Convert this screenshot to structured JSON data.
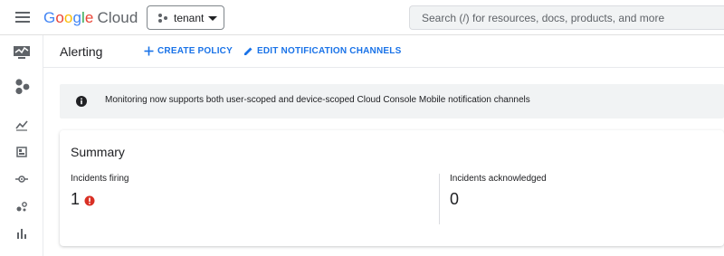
{
  "topbar": {
    "logo": {
      "g1": "G",
      "g2": "o",
      "g3": "o",
      "g4": "g",
      "g5": "l",
      "g6": "e",
      "cloud": "Cloud"
    },
    "project": "tenant",
    "search_placeholder": "Search (/) for resources, docs, products, and more",
    "icons": {
      "menu": "hamburger-menu-icon",
      "project": "project-dots-icon",
      "dropdown": "caret-down-icon"
    }
  },
  "sidebar": {
    "items": [
      {
        "name": "monitoring-product-icon"
      },
      {
        "name": "product-logo-icon"
      },
      {
        "name": "metrics-explorer-icon"
      },
      {
        "name": "dashboards-icon"
      },
      {
        "name": "integrations-icon"
      },
      {
        "name": "services-icon"
      },
      {
        "name": "bar-chart-icon"
      }
    ]
  },
  "header": {
    "title": "Alerting",
    "create_policy": "CREATE POLICY",
    "edit_channels": "EDIT NOTIFICATION CHANNELS"
  },
  "banner": {
    "message": "Monitoring now supports both user-scoped and device-scoped Cloud Console Mobile notification channels",
    "icon": "info-icon"
  },
  "summary": {
    "title": "Summary",
    "incidents_firing_label": "Incidents firing",
    "incidents_firing_value": "1",
    "incidents_ack_label": "Incidents acknowledged",
    "incidents_ack_value": "0",
    "firing_icon": "error-icon"
  },
  "colors": {
    "accent": "#1a73e8",
    "error": "#d93025",
    "banner_bg": "#f1f3f4",
    "icon_gray": "#5f6368"
  }
}
